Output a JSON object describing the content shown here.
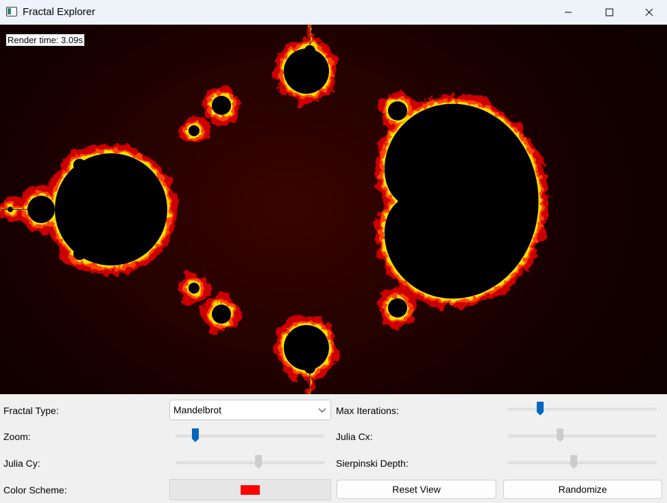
{
  "window": {
    "title": "Fractal Explorer",
    "icon": "app-window-icon",
    "controls": [
      "minimize-icon",
      "maximize-icon",
      "close-icon"
    ]
  },
  "canvas": {
    "render_time": "Render time: 3.09s",
    "fractal": "Mandelbrot",
    "colors": {
      "interior": "#000000",
      "background": "#1a0000",
      "edge_outer": "#cc0000",
      "edge_mid": "#ff4400",
      "edge_inner": "#ffdd00"
    }
  },
  "controls": {
    "fractal_type": {
      "label": "Fractal Type:",
      "value": "Mandelbrot"
    },
    "max_iterations": {
      "label": "Max Iterations:",
      "value": 0.2
    },
    "zoom": {
      "label": "Zoom:",
      "value": 0.11
    },
    "julia_cx": {
      "label": "Julia Cx:",
      "value": 0.34
    },
    "julia_cy": {
      "label": "Julia Cy:",
      "value": 0.56
    },
    "sierpinski_depth": {
      "label": "Sierpinski Depth:",
      "value": 0.44
    },
    "color_scheme": {
      "label": "Color Scheme:",
      "swatch_color": "#ff0000"
    },
    "reset_button": "Reset View",
    "randomize_button": "Randomize"
  },
  "theme": {
    "accent": "#0067c0",
    "disabled_thumb": "#cccccc"
  }
}
